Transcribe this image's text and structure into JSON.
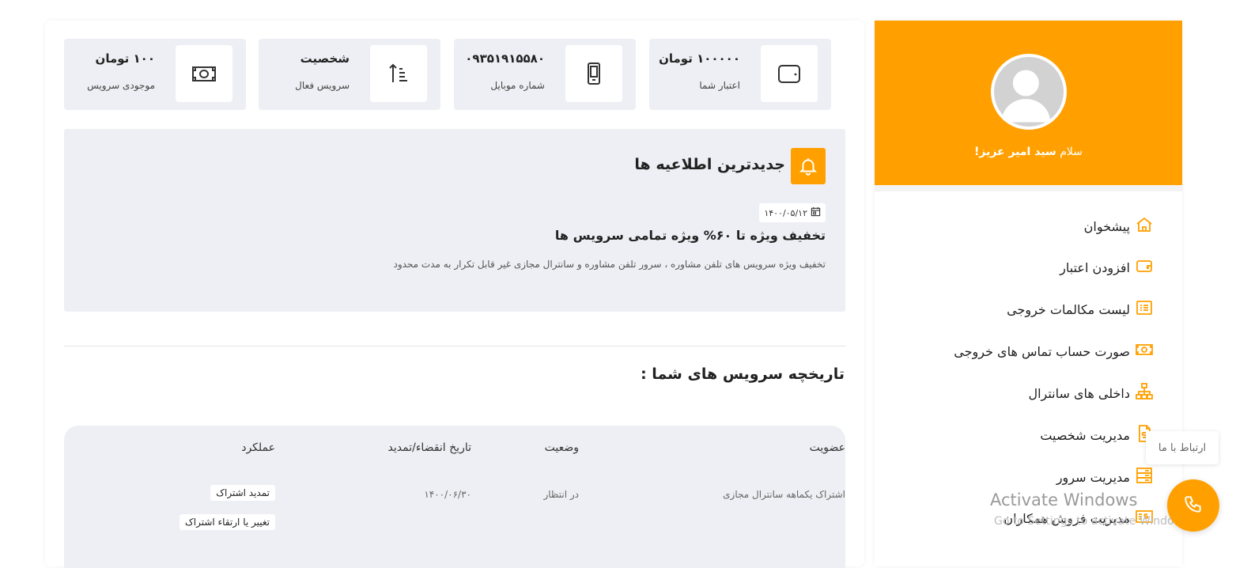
{
  "stats": [
    {
      "value": "۱۰۰۰۰۰ تومان",
      "label": "اعتبار شما",
      "icon": "wallet-icon"
    },
    {
      "value": "۰۹۳۵۱۹۱۵۵۸۰",
      "label": "شماره موبایل",
      "icon": "mobile-icon"
    },
    {
      "value": "شخصیت",
      "label": "سرویس فعال",
      "icon": "sort-icon"
    },
    {
      "value": "۱۰۰ تومان",
      "label": "موجودی سرویس",
      "icon": "money-icon"
    }
  ],
  "notices": {
    "heading": "جدیدترین اطلاعیه ها",
    "date": "۱۴۰۰/۰۵/۱۲",
    "title": "تخفیف ویژه تا ۶۰% ویژه تمامی سرویس ها",
    "body": "تخفیف ویژه سرویس های تلفن مشاوره ، سرور تلفن مشاوره و سانترال مجازی غیر قابل تکرار به مدت محدود"
  },
  "history": {
    "title": "تاریخچه سرویس های شما :",
    "columns": [
      "عضویت",
      "وضعیت",
      "تاریخ انقضاء/تمدید",
      "عملکرد"
    ],
    "rows": [
      {
        "membership": "اشتراک یکماهه سانترال مجازی",
        "status": "در انتظار",
        "date": "۱۴۰۰/۰۶/۳۰",
        "actions": [
          "تمدید اشتراک",
          "تغییر یا ارتقاء اشتراک"
        ]
      }
    ]
  },
  "sidebar": {
    "greeting_prefix": "سلام ",
    "user_name": "سید امیر عزیز!",
    "menu": [
      {
        "label": "پیشخوان",
        "icon": "home-icon"
      },
      {
        "label": "افزودن اعتبار",
        "icon": "wallet-icon"
      },
      {
        "label": "لیست مکالمات خروجی",
        "icon": "list-icon"
      },
      {
        "label": "صورت حساب تماس های خروجی",
        "icon": "money-icon"
      },
      {
        "label": "داخلی های سانترال",
        "icon": "sitemap-icon"
      },
      {
        "label": "مدیریت شخصیت",
        "icon": "invoice-icon"
      },
      {
        "label": "مدیریت سرور",
        "icon": "server-icon"
      },
      {
        "label": "مدیریت فروش همکاران",
        "icon": "money-list-icon"
      }
    ]
  },
  "contact": {
    "tooltip": "ارتباط با ما"
  },
  "watermark": {
    "line1": "Activate Windows",
    "line2": "Go to Settings to activate Windows."
  },
  "colors": {
    "accent": "#ffa000",
    "panel": "#eeeff4"
  }
}
